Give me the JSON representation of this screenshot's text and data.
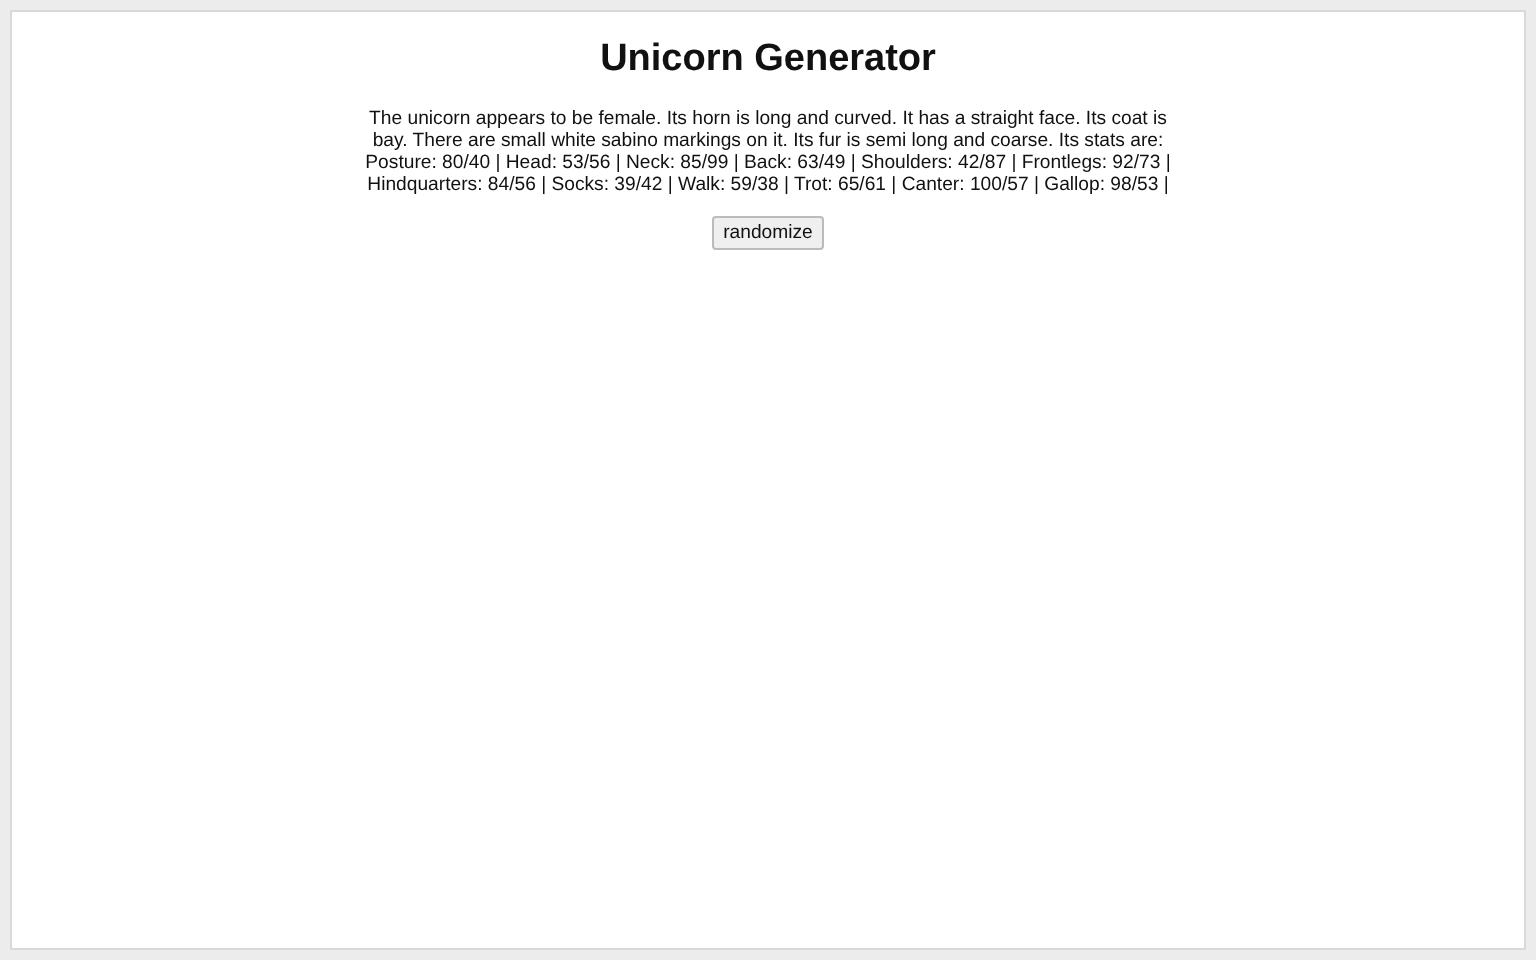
{
  "title": "Unicorn Generator",
  "description": "The unicorn appears to be female. Its horn is long and curved. It has a straight face. Its coat is bay. There are small white sabino markings on it. Its fur is semi long and coarse. Its stats are: Posture: 80/40 | Head: 53/56 | Neck: 85/99 | Back: 63/49 | Shoulders: 42/87 | Frontlegs: 92/73 | Hindquarters: 84/56 | Socks: 39/42 | Walk: 59/38 | Trot: 65/61 | Canter: 100/57 | Gallop: 98/53 |",
  "button": "randomize"
}
